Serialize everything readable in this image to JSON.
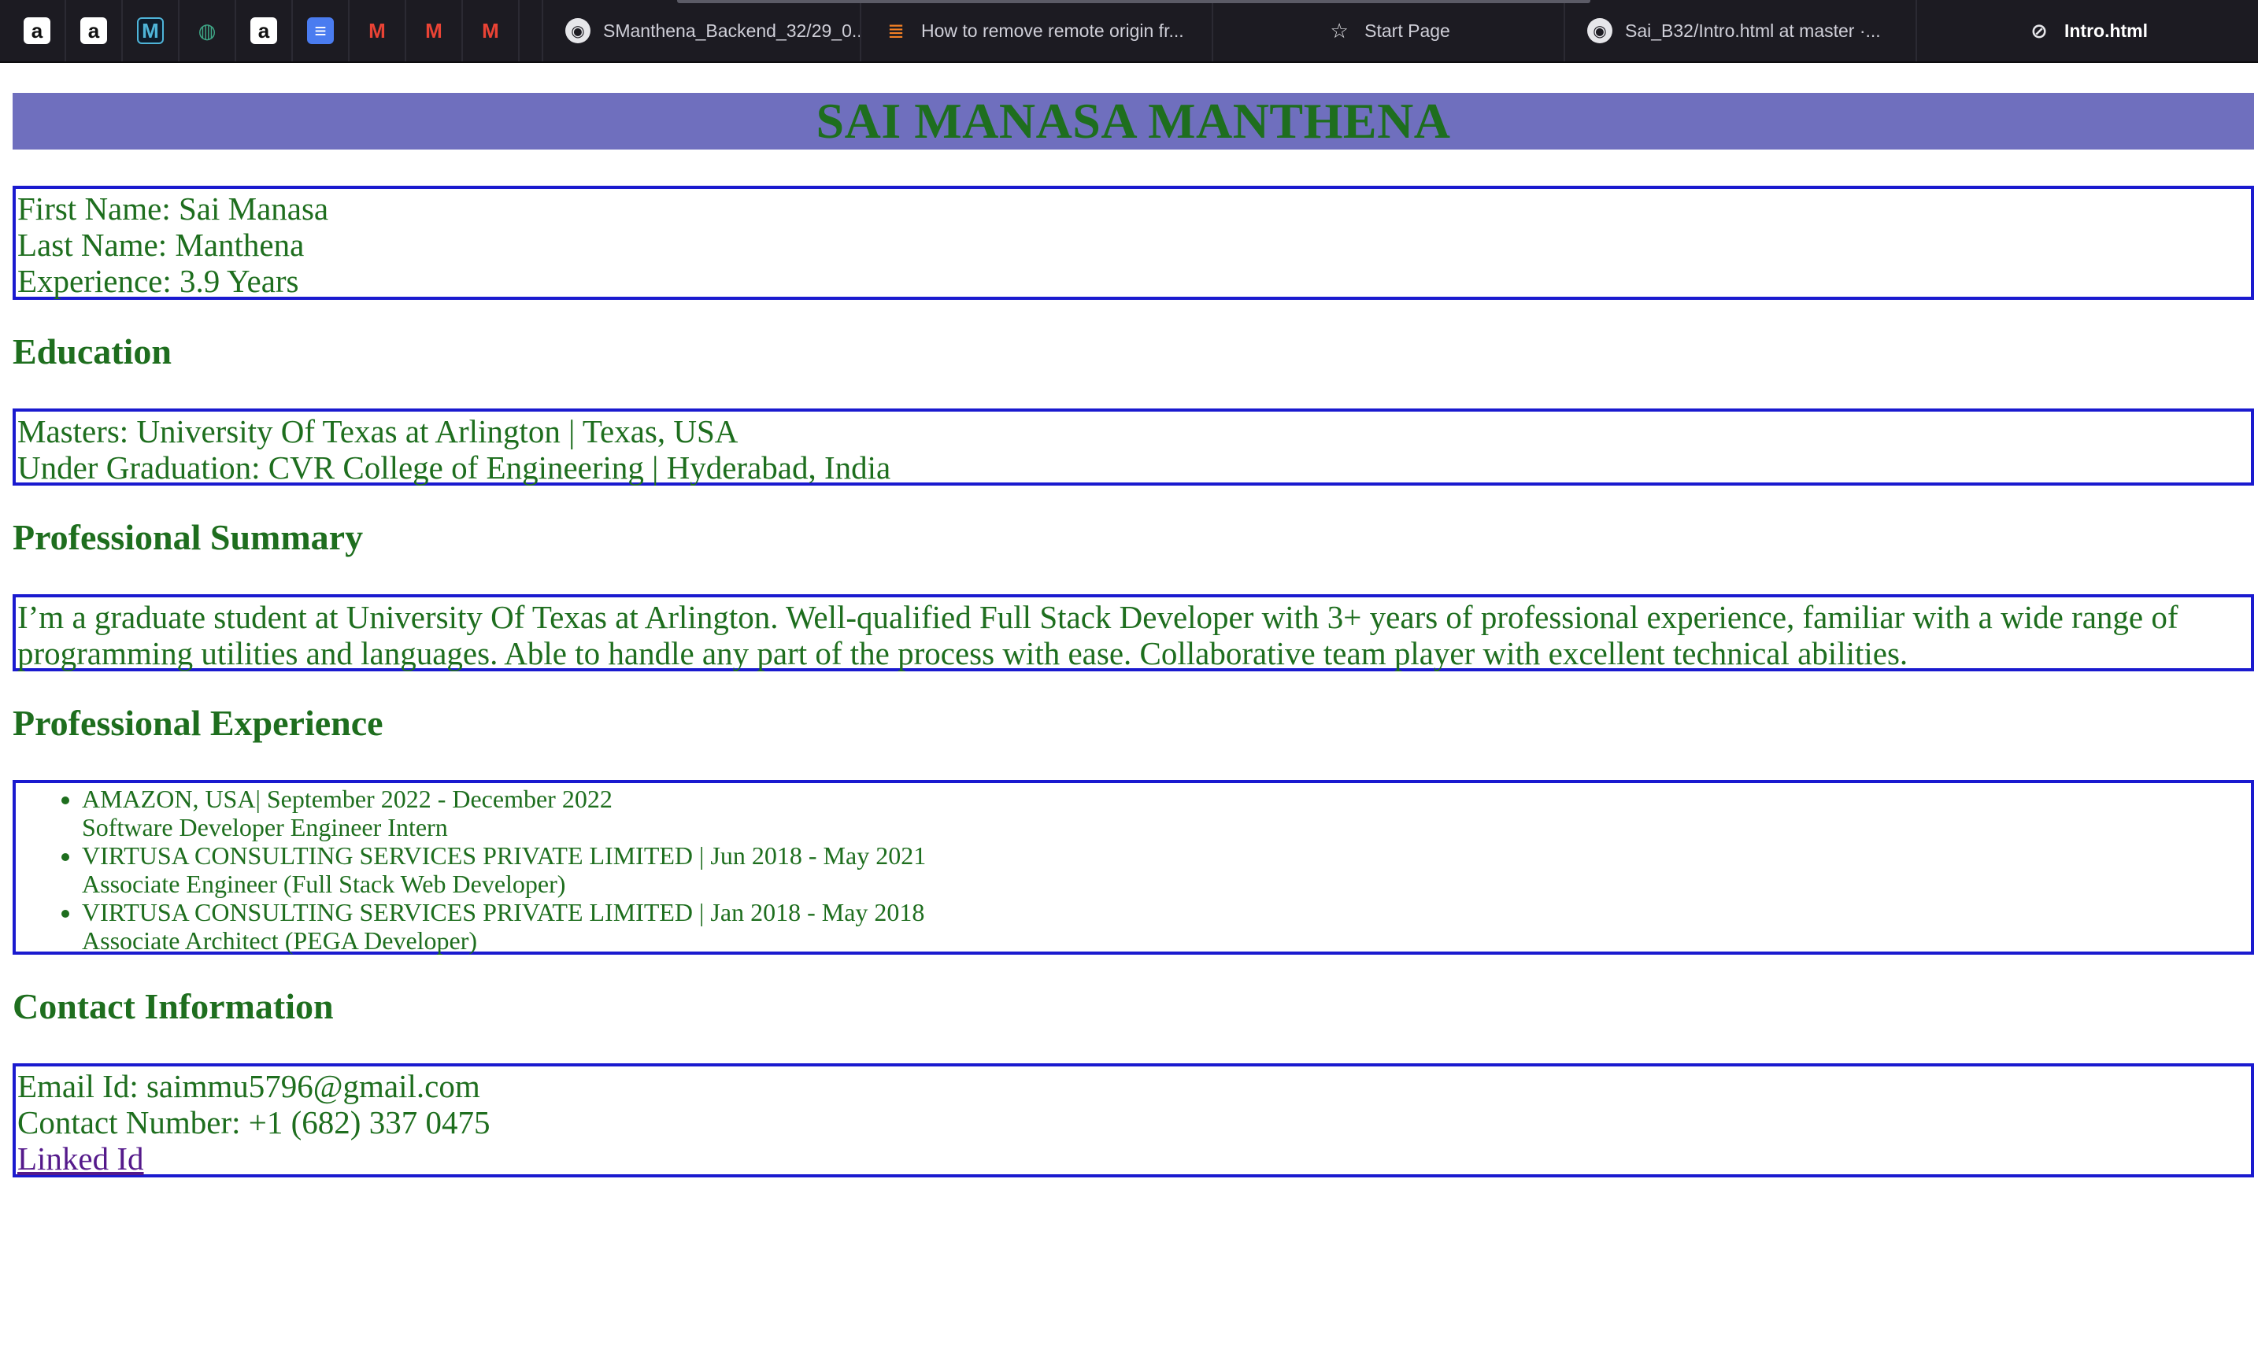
{
  "browser": {
    "pinned_tabs": [
      {
        "icon": "amazon-icon",
        "glyph": "a"
      },
      {
        "icon": "amazon-icon",
        "glyph": "a"
      },
      {
        "icon": "m-app-icon",
        "glyph": "M"
      },
      {
        "icon": "globe-icon",
        "glyph": "◍"
      },
      {
        "icon": "amazon-icon",
        "glyph": "a"
      },
      {
        "icon": "docs-icon",
        "glyph": "≡"
      },
      {
        "icon": "gmail-icon",
        "glyph": "M"
      },
      {
        "icon": "gmail-icon",
        "glyph": "M"
      },
      {
        "icon": "gmail-icon",
        "glyph": "M"
      }
    ],
    "tabs": [
      {
        "label": "SManthena_Backend_32/29_0...",
        "icon": "github-icon"
      },
      {
        "label": "How to remove remote origin fr...",
        "icon": "stackoverflow-icon"
      },
      {
        "label": "Start Page",
        "icon": "star-icon"
      },
      {
        "label": "Sai_B32/Intro.html at master ·...",
        "icon": "github-icon"
      },
      {
        "label": "Intro.html",
        "icon": "compass-icon",
        "active": true
      }
    ]
  },
  "page": {
    "name": "SAI MANASA MANTHENA",
    "info": {
      "first_name": "First Name: Sai Manasa",
      "last_name": "Last Name: Manthena",
      "experience": "Experience: 3.9 Years"
    },
    "education": {
      "heading": "Education",
      "masters": "Masters: University Of Texas at Arlington | Texas, USA",
      "undergrad": "Under Graduation: CVR College of Engineering | Hyderabad, India"
    },
    "summary": {
      "heading": "Professional Summary",
      "text": "I’m a graduate student at University Of Texas at Arlington. Well-qualified Full Stack Developer with 3+ years of professional experience, familiar with a wide range of programming utilities and languages. Able to handle any part of the process with ease. Collaborative team player with excellent technical abilities."
    },
    "experience": {
      "heading": "Professional Experience",
      "items": [
        {
          "company": "AMAZON, USA| September 2022 - December 2022",
          "role": "Software Developer Engineer Intern"
        },
        {
          "company": "VIRTUSA CONSULTING SERVICES PRIVATE LIMITED | Jun 2018 - May 2021",
          "role": "Associate Engineer (Full Stack Web Developer)"
        },
        {
          "company": "VIRTUSA CONSULTING SERVICES PRIVATE LIMITED | Jan 2018 - May 2018",
          "role": "Associate Architect (PEGA Developer)"
        }
      ]
    },
    "contact": {
      "heading": "Contact Information",
      "email": "Email Id: saimmu5796@gmail.com",
      "phone": "Contact Number: +1 (682) 337 0475",
      "linkedin": "Linked Id"
    }
  },
  "colors": {
    "banner": "#6f6fbe",
    "text": "#1e6e1e",
    "border": "#1a1acf",
    "link": "#551a8b"
  }
}
